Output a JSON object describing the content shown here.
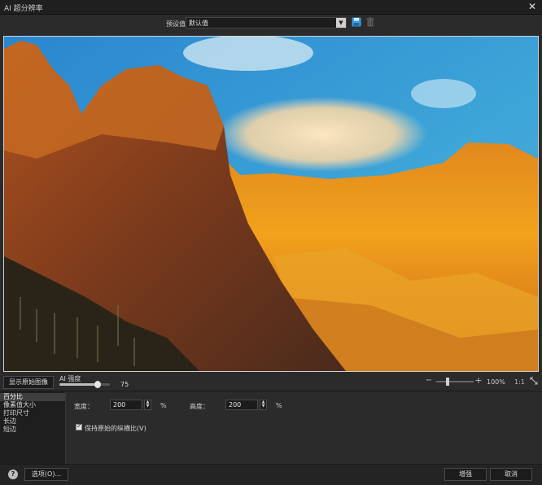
{
  "window": {
    "title": "AI 超分辨率",
    "close_icon": "close-icon"
  },
  "preset": {
    "label": "预设值",
    "value": "默认值",
    "save_icon": "save-icon",
    "delete_icon": "trash-icon"
  },
  "preview": {
    "image_description_icon": "landscape-image"
  },
  "controls": {
    "show_original_label": "显示原始图像",
    "strength_label": "AI 强度",
    "strength_value": "75",
    "strength_fraction": 0.75,
    "zoom_value": "100%",
    "zoom_fraction": 0.3,
    "one_to_one_label": "1:1"
  },
  "method_list": {
    "items": [
      "百分比",
      "像素值大小",
      "打印尺寸",
      "长边",
      "短边"
    ],
    "selected_index": 0
  },
  "settings": {
    "width_label": "宽度：",
    "width_value": "200",
    "height_label": "高度：",
    "height_value": "200",
    "unit": "%",
    "keep_ratio_label": "保持原始的纵横比(V)",
    "keep_ratio_checked": true
  },
  "footer": {
    "options_label": "选项(O)...",
    "enhance_label": "增强",
    "cancel_label": "取消"
  },
  "colors": {
    "window_bg": "#2b2b2b",
    "titlebar_bg": "#1f1f1f",
    "list_selected": "#3e3e3e",
    "save_icon_color": "#3d9ee8"
  }
}
